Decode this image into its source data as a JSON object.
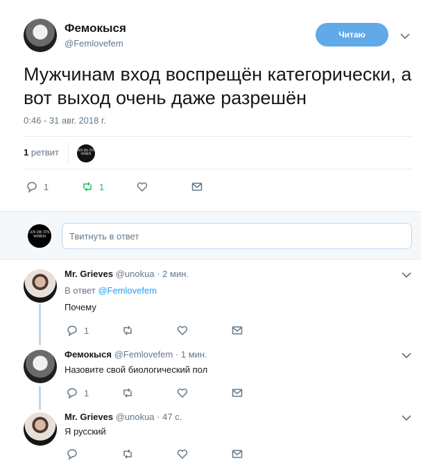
{
  "author": {
    "name": "Фемокыся",
    "handle": "@Femlovefem",
    "follow_label": "Читаю"
  },
  "tweet": {
    "text": "Мужчинам вход воспрещён категорически, а вот выход очень даже разрешён",
    "timestamp": "0:46 - 31 авг. 2018 г."
  },
  "stats": {
    "retweet_count": "1",
    "retweet_label": "ретвит",
    "avatar_text": "AN DE ITS WHEN"
  },
  "main_actions": {
    "reply_count": "1",
    "retweet_count": "1"
  },
  "reply_compose": {
    "placeholder": "Твитнуть в ответ",
    "avatar_text": "AN DE ITS WHEN"
  },
  "replies": [
    {
      "name": "Mr. Grieves",
      "handle": "@unokua",
      "time": "· 2 мин.",
      "reply_to_prefix": "В ответ",
      "reply_to_handle": "@Femlovefem",
      "text": "Почему",
      "reply_count": "1"
    },
    {
      "name": "Фемокыся",
      "handle": "@Femlovefem",
      "time": "· 1 мин.",
      "text": "Назовите свой биологический пол",
      "reply_count": "1"
    },
    {
      "name": "Mr. Grieves",
      "handle": "@unokua",
      "time": "· 47 с.",
      "text": "Я русский",
      "reply_count": ""
    }
  ],
  "colors": {
    "accent": "#1da1f2",
    "follow_button": "#62a9e8",
    "retweet_green": "#17bf63",
    "muted": "#657786"
  }
}
